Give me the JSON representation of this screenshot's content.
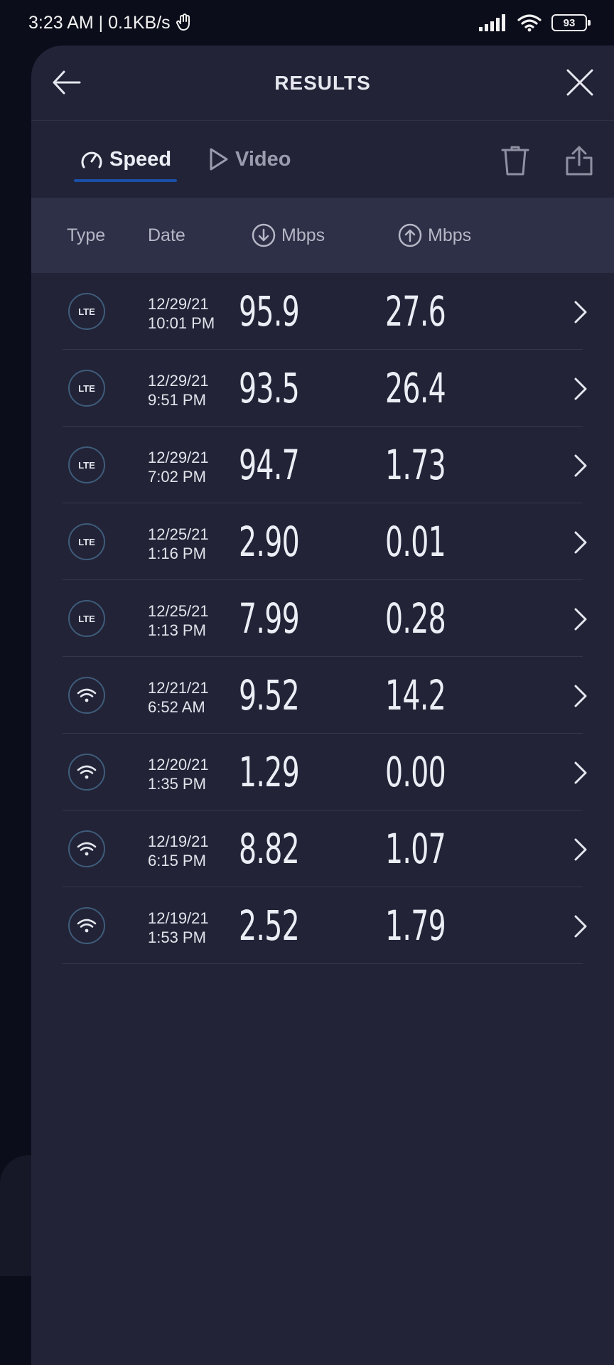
{
  "status": {
    "time": "3:23 AM | 0.1KB/s",
    "battery": "93",
    "battery_level": 93
  },
  "header": {
    "title": "RESULTS"
  },
  "tabs": [
    {
      "label": "Speed",
      "active": true
    },
    {
      "label": "Video",
      "active": false
    }
  ],
  "columns": {
    "type": "Type",
    "date": "Date",
    "download": "Mbps",
    "upload": "Mbps"
  },
  "results": [
    {
      "type": "LTE",
      "date": "12/29/21",
      "time": "10:01 PM",
      "download": "95.9",
      "upload": "27.6"
    },
    {
      "type": "LTE",
      "date": "12/29/21",
      "time": "9:51 PM",
      "download": "93.5",
      "upload": "26.4"
    },
    {
      "type": "LTE",
      "date": "12/29/21",
      "time": "7:02 PM",
      "download": "94.7",
      "upload": "1.73"
    },
    {
      "type": "LTE",
      "date": "12/25/21",
      "time": "1:16 PM",
      "download": "2.90",
      "upload": "0.01"
    },
    {
      "type": "LTE",
      "date": "12/25/21",
      "time": "1:13 PM",
      "download": "7.99",
      "upload": "0.28"
    },
    {
      "type": "wifi",
      "date": "12/21/21",
      "time": "6:52 AM",
      "download": "9.52",
      "upload": "14.2"
    },
    {
      "type": "wifi",
      "date": "12/20/21",
      "time": "1:35 PM",
      "download": "1.29",
      "upload": "0.00"
    },
    {
      "type": "wifi",
      "date": "12/19/21",
      "time": "6:15 PM",
      "download": "8.82",
      "upload": "1.07"
    },
    {
      "type": "wifi",
      "date": "12/19/21",
      "time": "1:53 PM",
      "download": "2.52",
      "upload": "1.79"
    }
  ],
  "colors": {
    "background": "#0b0d1a",
    "sheet": "#222337",
    "header_band": "#2e3047",
    "accent": "#1a4fa6"
  }
}
